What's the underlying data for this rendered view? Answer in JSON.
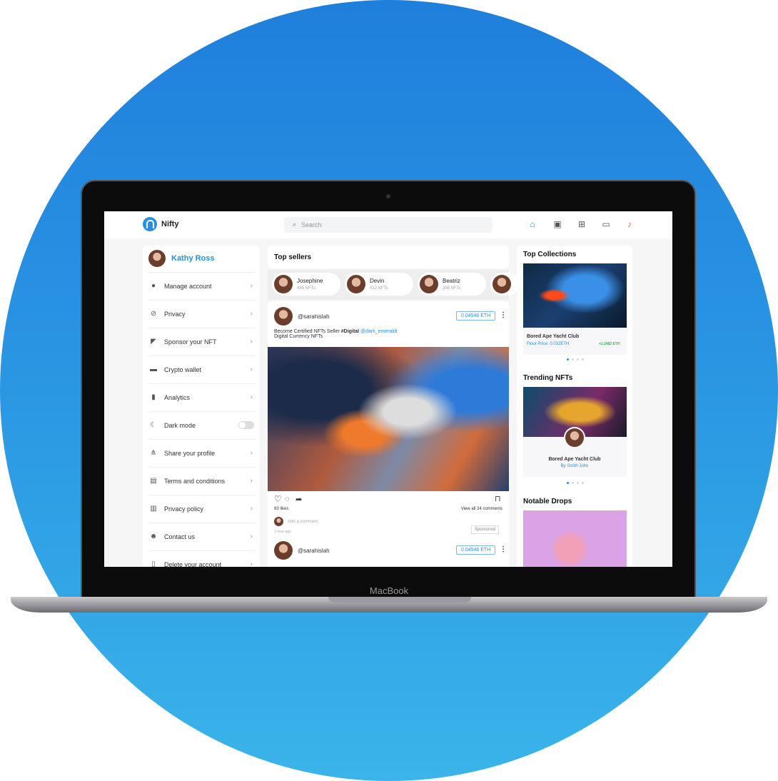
{
  "device": {
    "brand": "MacBook"
  },
  "app": {
    "name": "Nifty",
    "search_placeholder": "Search",
    "nav_icons": [
      "home-icon",
      "store-icon",
      "add-icon",
      "message-icon",
      "bell-icon"
    ],
    "accent": "#2a8fe0"
  },
  "sidebar": {
    "user": "Kathy Ross",
    "items": [
      {
        "label": "Manage account",
        "icon": "user-icon"
      },
      {
        "label": "Privacy",
        "icon": "eye-off-icon"
      },
      {
        "label": "Sponsor your NFT",
        "icon": "megaphone-icon"
      },
      {
        "label": "Crypto wallet",
        "icon": "wallet-icon"
      },
      {
        "label": "Analytics",
        "icon": "bar-chart-icon"
      },
      {
        "label": "Dark mode",
        "icon": "moon-icon",
        "toggle": false
      },
      {
        "label": "Share your profile",
        "icon": "share-icon"
      },
      {
        "label": "Terms and conditions",
        "icon": "document-icon"
      },
      {
        "label": "Privacy policy",
        "icon": "lock-doc-icon"
      },
      {
        "label": "Contact us",
        "icon": "contact-icon"
      },
      {
        "label": "Delete your account",
        "icon": "trash-icon"
      }
    ]
  },
  "top_sellers": {
    "title": "Top sellers",
    "sellers": [
      {
        "name": "Josephine",
        "count": "485 NFTs"
      },
      {
        "name": "Devin",
        "count": "412 NFTs"
      },
      {
        "name": "Beatriz",
        "count": "398 NFTs"
      }
    ]
  },
  "post": {
    "user": "@sarahislah",
    "price": "0.04546 ETH",
    "caption1": "Become Certified NFTs Seller ",
    "hashtag": "#Digital",
    "mention": " @dark_emeraldi",
    "caption2": "Digital Currency NFTs",
    "likes": "83 likes",
    "comments": "View all 24 comments",
    "comment_placeholder": "Add a comment",
    "time": "1 hour ago",
    "badge": "Sponsored"
  },
  "post2": {
    "user": "@sarahislah",
    "price": "0.04546 ETH"
  },
  "right": {
    "top_collections": {
      "title": "Top Collections",
      "name": "Bored Ape Yacht Club",
      "floor": "Floor Price: 0.032ETH",
      "change": "+2.2482 ETH",
      "change_color": "#2fbf5a"
    },
    "trending": {
      "title": "Trending NFTs",
      "name": "Bored Ape Yacht Club",
      "by": "By Smith John"
    },
    "notable": {
      "title": "Notable Drops"
    }
  }
}
